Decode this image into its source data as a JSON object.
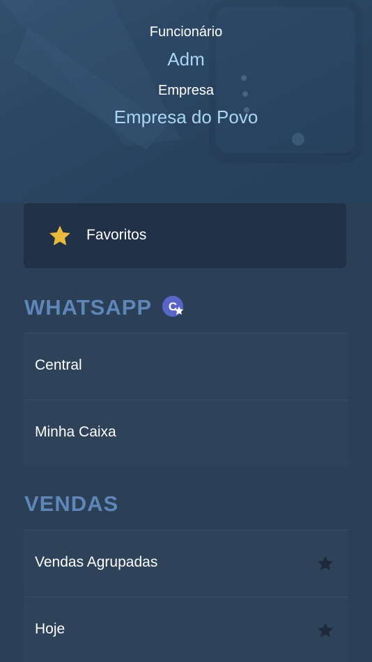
{
  "header": {
    "employee_label": "Funcionário",
    "employee_value": "Adm",
    "company_label": "Empresa",
    "company_value": "Empresa do Povo"
  },
  "favorites": {
    "label": "Favoritos",
    "icon": "star-icon",
    "icon_color": "#e8b93a"
  },
  "sections": {
    "whatsapp": {
      "title": "WHATSAPP",
      "badge_icon": "c-star-badge-icon",
      "items": [
        {
          "label": "Central"
        },
        {
          "label": "Minha Caixa"
        }
      ]
    },
    "vendas": {
      "title": "VENDAS",
      "items": [
        {
          "label": "Vendas Agrupadas",
          "icon": "star-outline-icon"
        },
        {
          "label": "Hoje",
          "icon": "star-outline-icon"
        }
      ]
    }
  },
  "colors": {
    "background": "#2b3f57",
    "section_title": "#5d86b9",
    "value_text": "#a9d6f3",
    "favorites_card": "#1f3047"
  }
}
